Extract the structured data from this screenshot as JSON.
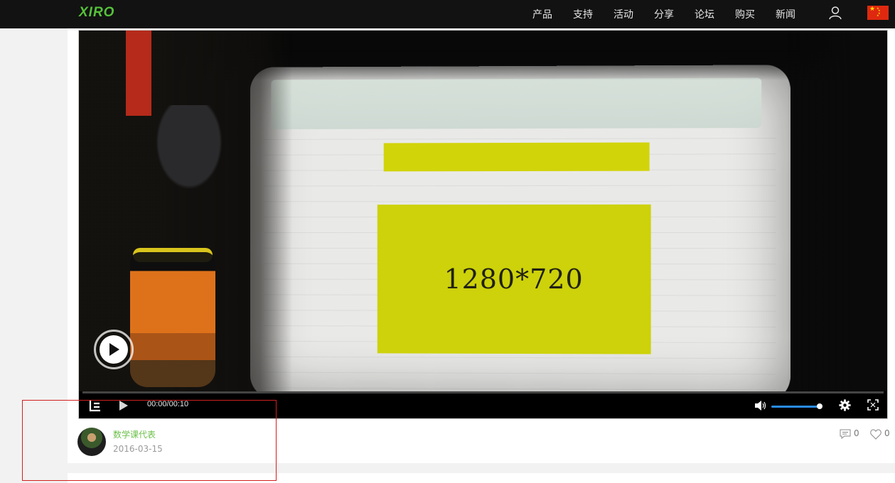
{
  "header": {
    "logo": "XIRO",
    "nav": [
      "产品",
      "支持",
      "活动",
      "分享",
      "论坛",
      "购买",
      "新闻"
    ],
    "user_icon": "user-icon",
    "flag_icon": "china-flag-icon"
  },
  "video": {
    "screen_text": "1280*720",
    "time": "00:00/00:10",
    "volume_level_fraction": 0.92,
    "icons": [
      "le-logo-icon",
      "play-icon",
      "volume-icon",
      "gear-icon",
      "fullscreen-icon"
    ],
    "accent_color": "#2a8df0"
  },
  "post": {
    "author": "数学课代表",
    "date": "2016-03-15",
    "comments": "0",
    "likes": "0",
    "author_color": "#6cc04a"
  }
}
